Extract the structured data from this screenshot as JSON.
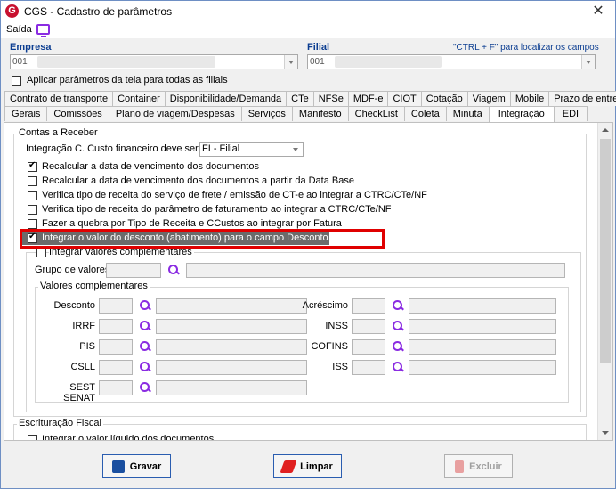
{
  "window": {
    "title": "CGS - Cadastro de parâmetros",
    "app_icon": "G"
  },
  "menu": {
    "saida": "Saída"
  },
  "empresa": {
    "label": "Empresa",
    "value": "001"
  },
  "filial": {
    "label": "Filial",
    "value": "001"
  },
  "hint": "\"CTRL + F\" para localizar os campos",
  "apply_all": {
    "label": "Aplicar parâmetros da tela para todas as filiais",
    "checked": false
  },
  "tabs_row1": [
    "Contrato de transporte",
    "Container",
    "Disponibilidade/Demanda",
    "CTe",
    "NFSe",
    "MDF-e",
    "CIOT",
    "Cotação",
    "Viagem",
    "Mobile",
    "Prazo de entrega"
  ],
  "tabs_row2": [
    "Gerais",
    "Comissões",
    "Plano de viagem/Despesas",
    "Serviços",
    "Manifesto",
    "CheckList",
    "Coleta",
    "Minuta",
    "Integração",
    "EDI"
  ],
  "active_tab": "Integração",
  "contas_receber": {
    "title": "Contas a Receber",
    "integracao_label": "Integração C. Custo financeiro deve ser por",
    "integracao_value": "FI   - Filial",
    "options": [
      {
        "label": "Recalcular a data de vencimento dos documentos",
        "checked": true
      },
      {
        "label": "Recalcular a data de vencimento dos documentos a partir da Data Base",
        "checked": false
      },
      {
        "label": "Verifica tipo de receita do serviço de frete / emissão de CT-e ao integrar a CTRC/CTe/NF",
        "checked": false
      },
      {
        "label": "Verifica tipo de receita do parâmetro de faturamento ao integrar a CTRC/CTe/NF",
        "checked": false
      },
      {
        "label": "Fazer a quebra por Tipo de Receita e CCustos ao integrar por Fatura",
        "checked": false
      },
      {
        "label": "Integrar o valor do desconto (abatimento) para o campo Desconto Financeiro",
        "checked": true
      }
    ],
    "integrar_valores": {
      "label": "Integrar valores complementares",
      "checked": false
    },
    "grupo_label": "Grupo de valores",
    "valores_title": "Valores complementares",
    "left_fields": [
      "Desconto",
      "IRRF",
      "PIS",
      "CSLL",
      "SEST SENAT"
    ],
    "right_fields": [
      "Acréscimo",
      "INSS",
      "COFINS",
      "ISS"
    ]
  },
  "escrituracao": {
    "title": "Escrituração Fiscal",
    "option": {
      "label": "Integrar o valor líquido dos documentos",
      "checked": false
    }
  },
  "buttons": {
    "gravar": "Gravar",
    "limpar": "Limpar",
    "excluir": "Excluir"
  }
}
